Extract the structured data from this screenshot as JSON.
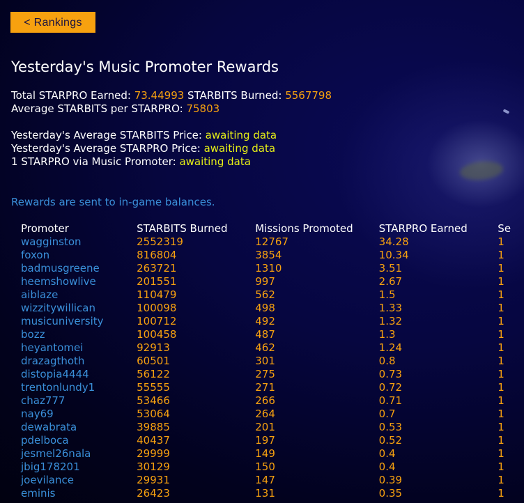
{
  "back_button": {
    "label": "< Rankings"
  },
  "title": "Yesterday's Music Promoter Rewards",
  "stats": {
    "total_label": "Total STARPRO Earned: ",
    "total_value": "73.44993",
    "burned_label": " STARBITS Burned: ",
    "burned_value": "5567798",
    "average_label": "Average STARBITS per STARPRO: ",
    "average_value": "75803",
    "starbits_price_label": "Yesterday's Average STARBITS Price: ",
    "starbits_price_value": "awaiting data",
    "starpro_price_label": "Yesterday's Average STARPRO Price: ",
    "starpro_price_value": "awaiting data",
    "via_label": "1 STARPRO via Music Promoter: ",
    "via_value": "awaiting data"
  },
  "notice": "Rewards are sent to in-game balances.",
  "table": {
    "headers": [
      "Promoter",
      "STARBITS Burned",
      "Missions Promoted",
      "STARPRO Earned",
      "Se"
    ],
    "rows": [
      [
        "wagginston",
        "2552319",
        "12767",
        "34.28",
        "1"
      ],
      [
        "foxon",
        "816804",
        "3854",
        "10.34",
        "1"
      ],
      [
        "badmusgreene",
        "263721",
        "1310",
        "3.51",
        "1"
      ],
      [
        "heemshowlive",
        "201551",
        "997",
        "2.67",
        "1"
      ],
      [
        "aiblaze",
        "110479",
        "562",
        "1.5",
        "1"
      ],
      [
        "wizzitywillican",
        "100098",
        "498",
        "1.33",
        "1"
      ],
      [
        "musicuniversity",
        "100712",
        "492",
        "1.32",
        "1"
      ],
      [
        "bozz",
        "100458",
        "487",
        "1.3",
        "1"
      ],
      [
        "heyantomei",
        "92913",
        "462",
        "1.24",
        "1"
      ],
      [
        "drazagthoth",
        "60501",
        "301",
        "0.8",
        "1"
      ],
      [
        "distopia4444",
        "56122",
        "275",
        "0.73",
        "1"
      ],
      [
        "trentonlundy1",
        "55555",
        "271",
        "0.72",
        "1"
      ],
      [
        "chaz777",
        "53466",
        "266",
        "0.71",
        "1"
      ],
      [
        "nay69",
        "53064",
        "264",
        "0.7",
        "1"
      ],
      [
        "dewabrata",
        "39885",
        "201",
        "0.53",
        "1"
      ],
      [
        "pdelboca",
        "40437",
        "197",
        "0.52",
        "1"
      ],
      [
        "jesmel26nala",
        "29999",
        "149",
        "0.4",
        "1"
      ],
      [
        "jbig178201",
        "30129",
        "150",
        "0.4",
        "1"
      ],
      [
        "joevilance",
        "29931",
        "147",
        "0.39",
        "1"
      ],
      [
        "eminis",
        "26423",
        "131",
        "0.35",
        "1"
      ]
    ]
  },
  "colors": {
    "accent_orange": "#f7a10f",
    "link_blue": "#3a8fd9",
    "highlight_yellow": "#e8f016"
  }
}
